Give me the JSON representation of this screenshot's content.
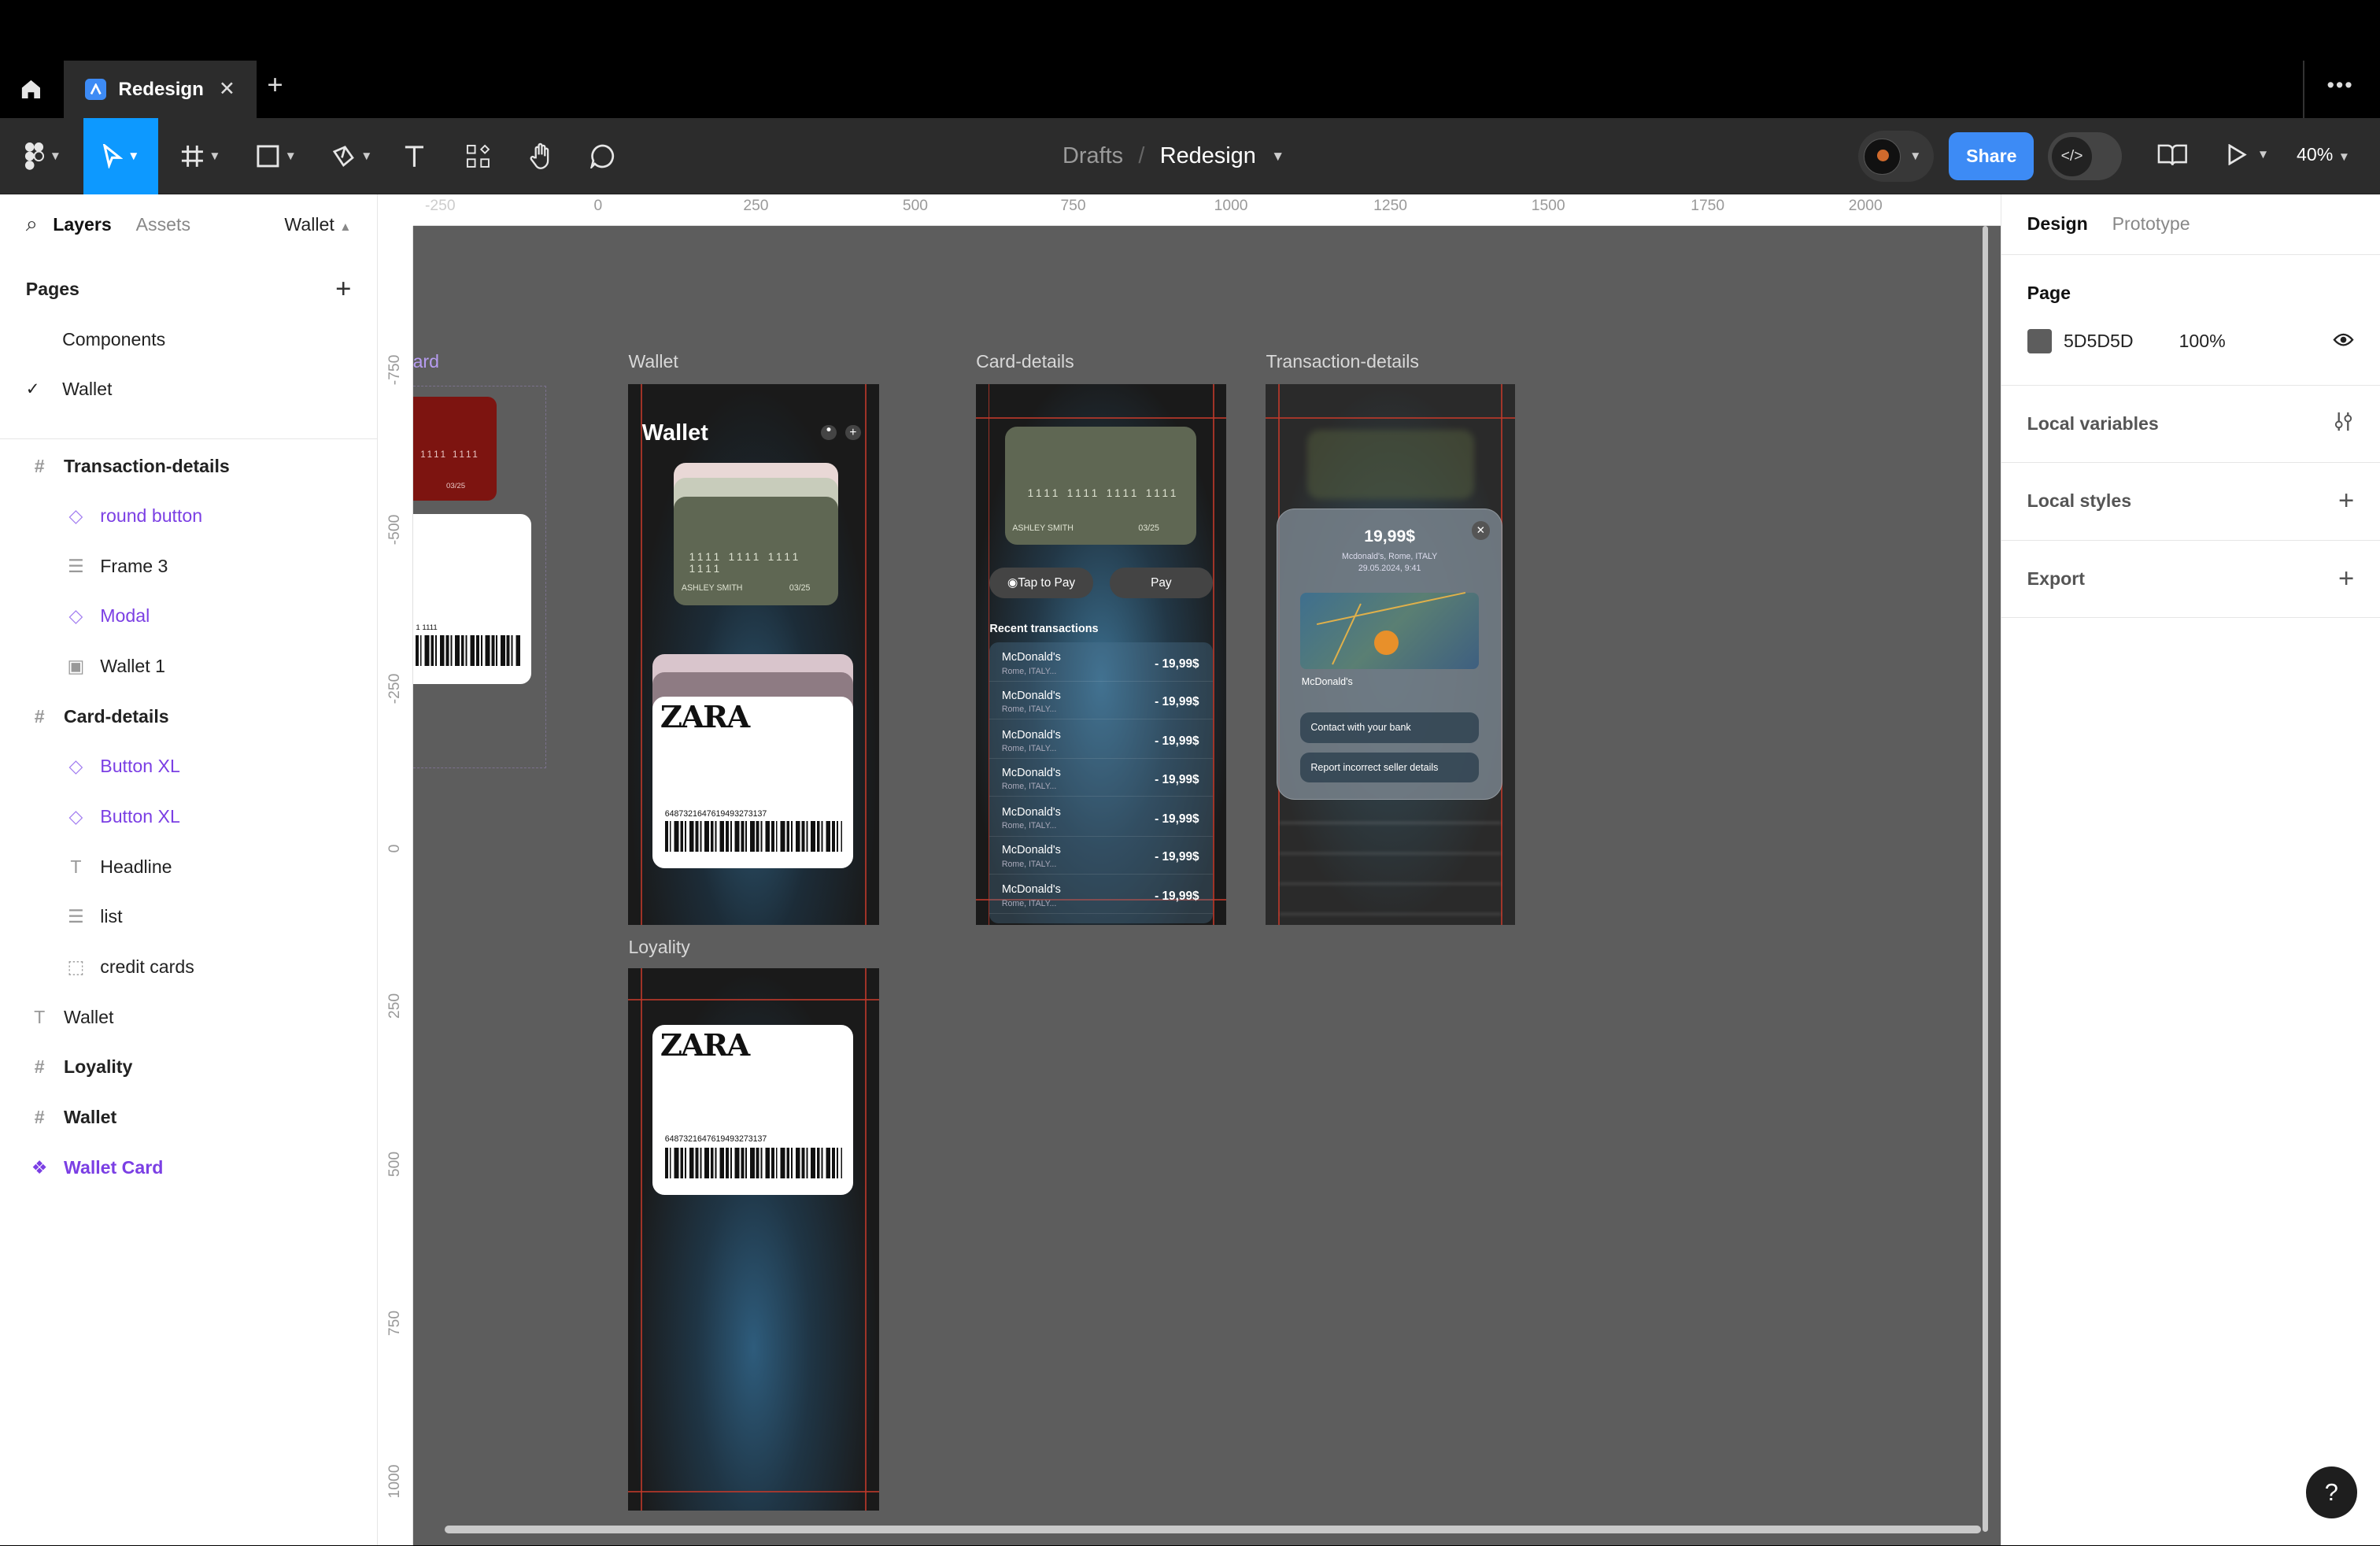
{
  "tabbar": {
    "tab_title": "Redesign"
  },
  "toolbar": {
    "crumb_parent": "Drafts",
    "crumb_sep": "/",
    "crumb_title": "Redesign",
    "share_label": "Share",
    "zoom": "40%"
  },
  "left_panel": {
    "tab_layers": "Layers",
    "tab_assets": "Assets",
    "page_selector": "Wallet",
    "pages_heading": "Pages",
    "pages": [
      {
        "label": "Components"
      },
      {
        "label": "Wallet"
      }
    ],
    "layers": [
      {
        "label": "Transaction-details"
      },
      {
        "label": "round button"
      },
      {
        "label": "Frame 3"
      },
      {
        "label": "Modal"
      },
      {
        "label": "Wallet 1"
      },
      {
        "label": "Card-details"
      },
      {
        "label": "Button XL"
      },
      {
        "label": "Button XL"
      },
      {
        "label": "Headline"
      },
      {
        "label": "list"
      },
      {
        "label": "credit cards"
      },
      {
        "label": "Wallet"
      },
      {
        "label": "Loyality"
      },
      {
        "label": "Wallet"
      },
      {
        "label": "Wallet Card"
      }
    ]
  },
  "right_panel": {
    "tab_design": "Design",
    "tab_prototype": "Prototype",
    "page_heading": "Page",
    "page_color": "5D5D5D",
    "page_opacity": "100%",
    "local_variables": "Local variables",
    "local_styles": "Local styles",
    "export": "Export",
    "help": "?"
  },
  "canvas": {
    "ruler_top": [
      "-250",
      "0",
      "250",
      "500",
      "750",
      "1000",
      "1250",
      "1500",
      "1750",
      "2000"
    ],
    "ruler_left": [
      "-750",
      "-500",
      "-250",
      "0",
      "250",
      "500",
      "750",
      "1000"
    ],
    "frame_labels": {
      "partial": "ard",
      "wallet": "Wallet",
      "card_details": "Card-details",
      "transaction_details": "Transaction-details",
      "loyality": "Loyality"
    },
    "partial_card": {
      "digits": "1111 1111",
      "expiry": "03/25",
      "barcode_digits": "1 1111"
    },
    "wallet": {
      "title": "Wallet",
      "card_number": "1111 1111 1111 1111",
      "card_holder": "ASHLEY SMITH",
      "card_expiry": "03/25",
      "brand": "ZARA",
      "loyalty_number": "6487321647619493273137"
    },
    "card_details": {
      "card_number": "1111 1111 1111 1111",
      "card_holder": "ASHLEY SMITH",
      "card_expiry": "03/25",
      "btn_tap": "Tap to Pay",
      "btn_pay": "Pay",
      "recent_heading": "Recent transactions",
      "transactions": [
        {
          "name": "McDonald's",
          "sub": "Rome, ITALY...",
          "amount": "- 19,99$"
        },
        {
          "name": "McDonald's",
          "sub": "Rome, ITALY...",
          "amount": "- 19,99$"
        },
        {
          "name": "McDonald's",
          "sub": "Rome, ITALY...",
          "amount": "- 19,99$"
        },
        {
          "name": "McDonald's",
          "sub": "Rome, ITALY...",
          "amount": "- 19,99$"
        },
        {
          "name": "McDonald's",
          "sub": "Rome, ITALY...",
          "amount": "- 19,99$"
        },
        {
          "name": "McDonald's",
          "sub": "Rome, ITALY...",
          "amount": "- 19,99$"
        },
        {
          "name": "McDonald's",
          "sub": "Rome, ITALY...",
          "amount": "- 19,99$"
        }
      ]
    },
    "transaction_details": {
      "amount": "19,99$",
      "merchant_line": "Mcdonald's, Rome, ITALY",
      "date_line": "29.05.2024, 9:41",
      "map_label": "McDonald's",
      "btn_contact": "Contact with your bank",
      "btn_report": "Report incorrect seller details"
    },
    "loyality": {
      "brand": "ZARA",
      "loyalty_number": "6487321647619493273137"
    }
  },
  "colors": {
    "accent": "#0d99ff",
    "share": "#3d8bf5",
    "component": "#7b3fe4",
    "canvas": "#5d5d5d",
    "guide": "#c0392b"
  }
}
